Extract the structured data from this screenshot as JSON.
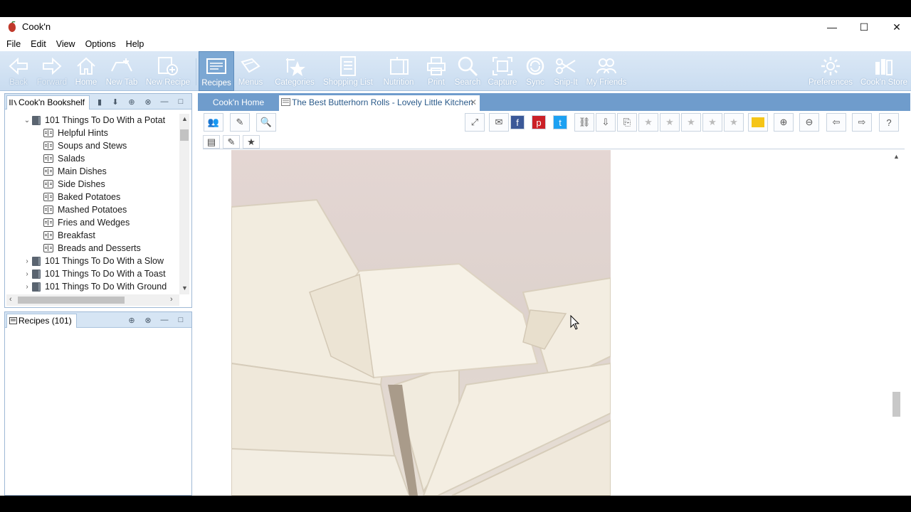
{
  "window": {
    "title": "Cook'n",
    "controls": {
      "minimize": "—",
      "maximize": "☐",
      "close": "✕"
    }
  },
  "menu": [
    "File",
    "Edit",
    "View",
    "Options",
    "Help"
  ],
  "toolbar": {
    "items": [
      {
        "label": "Back",
        "icon": "back-arrow-icon",
        "enabled": false
      },
      {
        "label": "Forward",
        "icon": "forward-arrow-icon",
        "enabled": false
      },
      {
        "label": "Home",
        "icon": "home-icon",
        "enabled": true
      },
      {
        "label": "New Tab",
        "icon": "new-tab-icon",
        "enabled": true
      },
      {
        "label": "New Recipe",
        "icon": "new-recipe-icon",
        "enabled": true
      },
      {
        "label": "Recipes",
        "icon": "recipes-icon",
        "enabled": true,
        "active": true
      },
      {
        "label": "Menus",
        "icon": "menus-icon",
        "enabled": true
      },
      {
        "label": "Categories",
        "icon": "categories-icon",
        "enabled": true
      },
      {
        "label": "Shopping List",
        "icon": "shopping-list-icon",
        "enabled": true
      },
      {
        "label": "Nutrition",
        "icon": "nutrition-icon",
        "enabled": true
      },
      {
        "label": "Print",
        "icon": "print-icon",
        "enabled": true
      },
      {
        "label": "Search",
        "icon": "search-icon",
        "enabled": true
      },
      {
        "label": "Capture",
        "icon": "capture-icon",
        "enabled": true
      },
      {
        "label": "Sync",
        "icon": "sync-icon",
        "enabled": true
      },
      {
        "label": "Snip-It",
        "icon": "scissors-icon",
        "enabled": true
      },
      {
        "label": "My Friends",
        "icon": "friends-icon",
        "enabled": true
      },
      {
        "label": "Preferences",
        "icon": "gear-icon",
        "enabled": true
      },
      {
        "label": "Cook'n Store",
        "icon": "store-icon",
        "enabled": true
      }
    ]
  },
  "bookshelf": {
    "tab_label": "Cook'n Bookshelf",
    "tree": [
      {
        "label": "101 Things To Do With a Potat",
        "level": 0,
        "expanded": true,
        "type": "book"
      },
      {
        "label": "Helpful Hints",
        "level": 1,
        "type": "chapter"
      },
      {
        "label": "Soups and Stews",
        "level": 1,
        "type": "chapter"
      },
      {
        "label": "Salads",
        "level": 1,
        "type": "chapter"
      },
      {
        "label": "Main Dishes",
        "level": 1,
        "type": "chapter"
      },
      {
        "label": "Side Dishes",
        "level": 1,
        "type": "chapter"
      },
      {
        "label": "Baked Potatoes",
        "level": 1,
        "type": "chapter"
      },
      {
        "label": "Mashed Potatoes",
        "level": 1,
        "type": "chapter"
      },
      {
        "label": "Fries and Wedges",
        "level": 1,
        "type": "chapter"
      },
      {
        "label": "Breakfast",
        "level": 1,
        "type": "chapter"
      },
      {
        "label": "Breads and Desserts",
        "level": 1,
        "type": "chapter"
      },
      {
        "label": "101 Things To Do With a Slow",
        "level": 0,
        "expanded": false,
        "type": "book"
      },
      {
        "label": "101 Things To Do With a Toast",
        "level": 0,
        "expanded": false,
        "type": "book"
      },
      {
        "label": "101 Things To Do With Ground",
        "level": 0,
        "expanded": false,
        "type": "book"
      }
    ]
  },
  "recipes_pane": {
    "tab_label": "Recipes (101)"
  },
  "tabs": {
    "home": "Cook'n Home",
    "active": "The Best Butterhorn Rolls - Lovely Little Kitchen",
    "close": "✕"
  },
  "colors": {
    "toolbar_bg": "#c9dcf0",
    "tabbar_bg": "#6f9ccc",
    "active_tool": "#7ba7d3",
    "photo_bg": "#e7ddd9"
  }
}
